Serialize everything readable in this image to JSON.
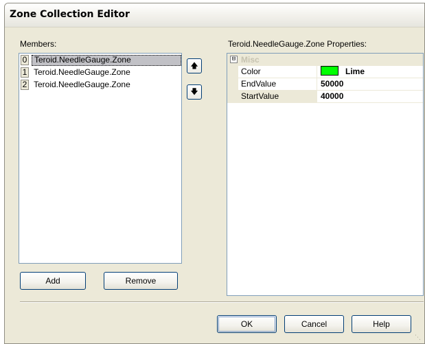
{
  "window": {
    "title": "Zone Collection Editor"
  },
  "members": {
    "label": "Members:",
    "items": [
      {
        "index": "0",
        "text": "Teroid.NeedleGauge.Zone",
        "selected": true
      },
      {
        "index": "1",
        "text": "Teroid.NeedleGauge.Zone",
        "selected": false
      },
      {
        "index": "2",
        "text": "Teroid.NeedleGauge.Zone",
        "selected": false
      }
    ],
    "move_up_icon": "arrow-up-icon",
    "move_down_icon": "arrow-down-icon",
    "add_label": "Add",
    "remove_label": "Remove"
  },
  "properties": {
    "label": "Teroid.NeedleGauge.Zone Properties:",
    "category": {
      "toggle": "⊟",
      "name": "Misc"
    },
    "rows": [
      {
        "name": "Color",
        "value": "Lime",
        "swatch": "#00ff00",
        "selected": false
      },
      {
        "name": "EndValue",
        "value": "50000",
        "selected": false
      },
      {
        "name": "StartValue",
        "value": "40000",
        "selected": true
      }
    ]
  },
  "buttons": {
    "ok": "OK",
    "cancel": "Cancel",
    "help": "Help"
  }
}
